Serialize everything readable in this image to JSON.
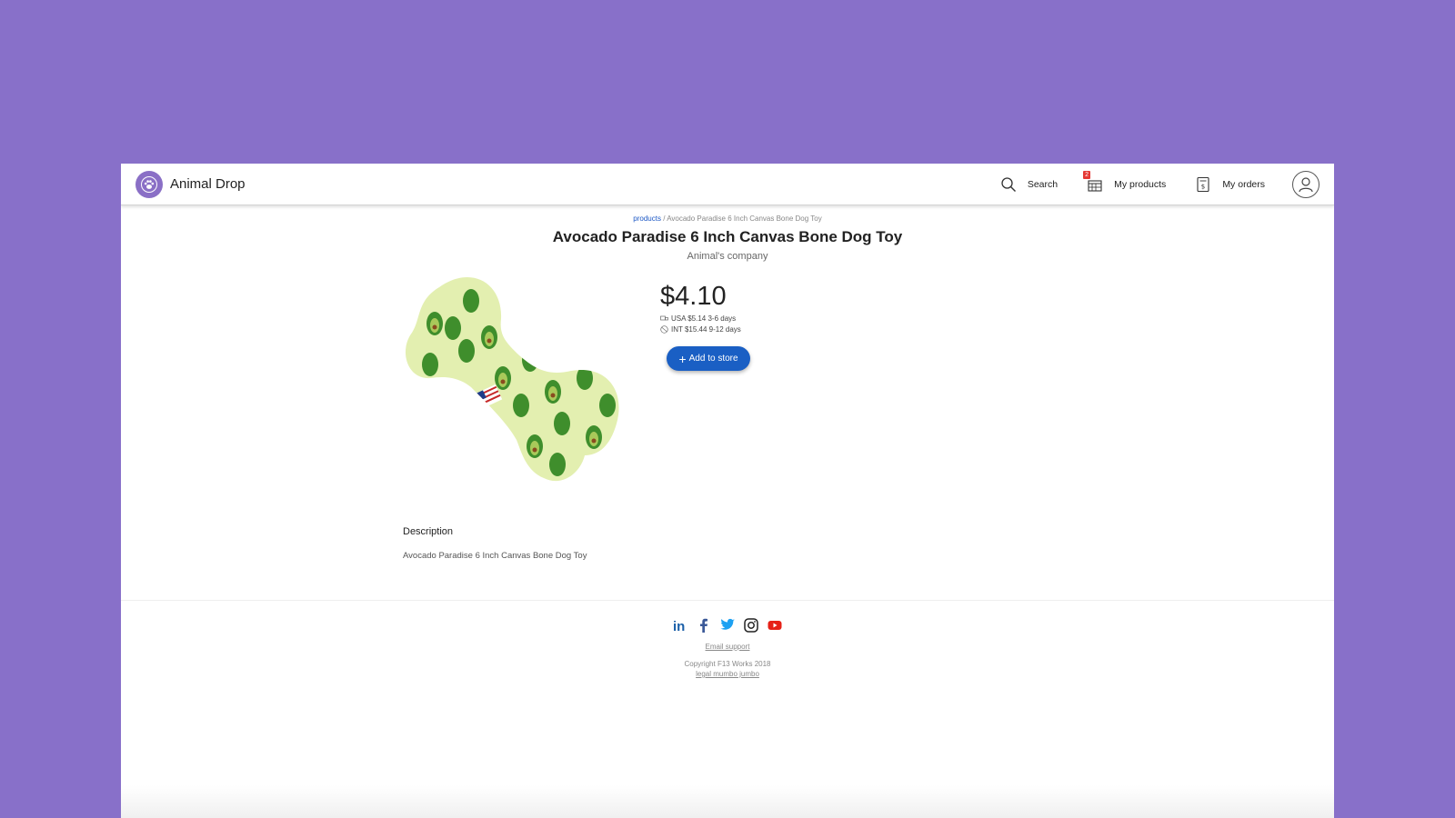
{
  "header": {
    "brand": "Animal Drop",
    "logo_icon": "paw-icon",
    "nav": {
      "search": "Search",
      "my_products": "My products",
      "my_products_badge": "2",
      "my_orders": "My orders"
    }
  },
  "breadcrumb": {
    "root": "products",
    "separator": "/",
    "current": "Avocado Paradise 6 Inch Canvas Bone Dog Toy"
  },
  "product": {
    "title": "Avocado Paradise 6 Inch Canvas Bone Dog Toy",
    "company": "Animal's company",
    "price": "$4.10",
    "shipping_usa": "USA $5.14 3-6 days",
    "shipping_int": "INT $15.44 9-12 days",
    "add_button": "Add to store",
    "description_heading": "Description",
    "description_text": "Avocado Paradise 6 Inch Canvas Bone Dog Toy"
  },
  "footer": {
    "social_icons": [
      "linkedin-icon",
      "facebook-icon",
      "twitter-icon",
      "instagram-icon",
      "youtube-icon"
    ],
    "email_support": "Email support",
    "copyright": "Copyright F13 Works 2018",
    "legal": "legal mumbo jumbo"
  },
  "colors": {
    "background": "#8870c9",
    "accent": "#1a5fc4",
    "badge": "#e53935"
  }
}
